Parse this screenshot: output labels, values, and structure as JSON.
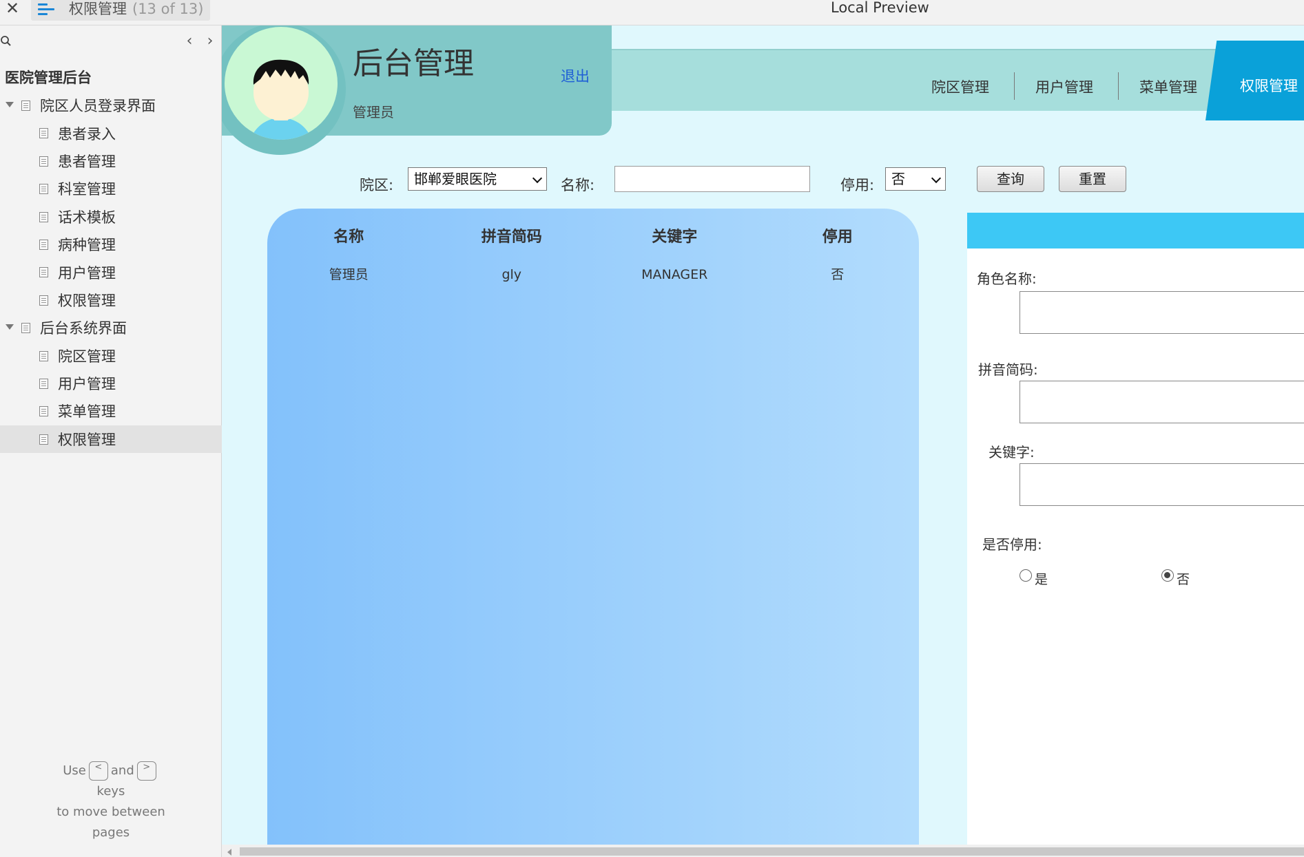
{
  "topbar": {
    "close_glyph": "✕",
    "tab_title": "权限管理",
    "tab_count": "(13 of 13)",
    "window_title": "Local Preview"
  },
  "sidebar": {
    "nav_prev": "‹",
    "nav_next": "›",
    "root": "医院管理后台",
    "groups": [
      {
        "label": "院区人员登录界面",
        "items": [
          "患者录入",
          "患者管理",
          "科室管理",
          "话术模板",
          "病种管理",
          "用户管理",
          "权限管理"
        ]
      },
      {
        "label": "后台系统界面",
        "items": [
          "院区管理",
          "用户管理",
          "菜单管理",
          "权限管理"
        ]
      }
    ],
    "selected": "后台系统界面/权限管理",
    "hint": {
      "use": "Use",
      "prev_key": "<",
      "and": "and",
      "next_key": ">",
      "keys": "keys",
      "to_move": "to move between",
      "pages": "pages"
    }
  },
  "header": {
    "title": "后台管理",
    "role": "管理员",
    "logout": "退出",
    "nav": [
      "院区管理",
      "用户管理",
      "菜单管理"
    ],
    "nav_active": "权限管理"
  },
  "filter": {
    "campus_label": "院区:",
    "campus_value": "邯郸爱眼医院",
    "name_label": "名称:",
    "name_value": "",
    "disabled_label": "停用:",
    "disabled_value": "否",
    "query_button": "查询",
    "reset_button": "重置"
  },
  "table": {
    "columns": [
      "名称",
      "拼音简码",
      "关键字",
      "停用"
    ],
    "rows": [
      [
        "管理员",
        "gly",
        "MANAGER",
        "否"
      ]
    ]
  },
  "edit": {
    "role_name_label": "角色名称:",
    "pinyin_label": "拼音简码:",
    "keyword_label": "关键字:",
    "disabled_label": "是否停用:",
    "option_yes": "是",
    "option_no": "否",
    "selected_option": "否"
  },
  "colors": {
    "accent": "#0aa1d9",
    "header_card": "#81c8c8",
    "header_strip": "#a6dedc",
    "panel_left": "#83c1fb",
    "panel_right": "#b2dcfd",
    "edit_bar": "#3dc8f5",
    "background": "#e0f8fd",
    "link": "#1f5fd6"
  }
}
